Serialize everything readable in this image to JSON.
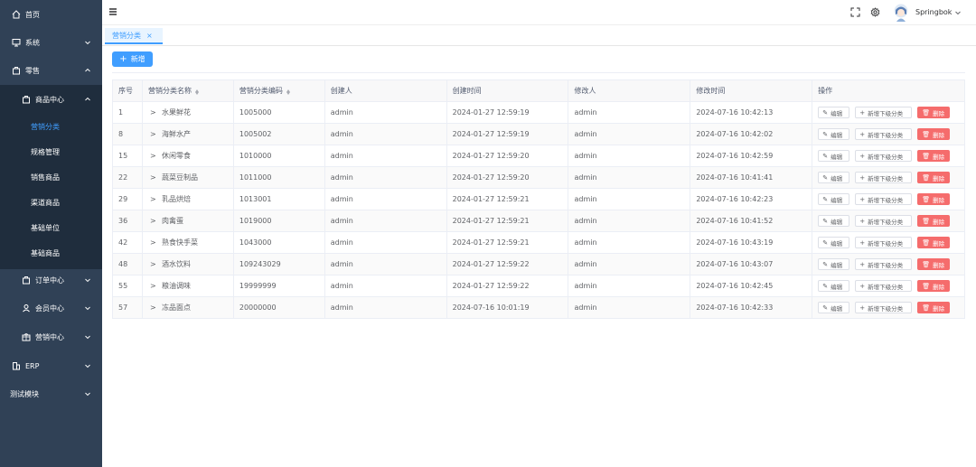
{
  "sidebar": {
    "items": [
      {
        "label": "首页",
        "icon": "home-icon"
      },
      {
        "label": "系统",
        "icon": "monitor-icon"
      },
      {
        "label": "零售",
        "icon": "shop-icon"
      },
      {
        "label": "商品中心",
        "icon": "bag-icon"
      },
      {
        "label": "营销分类",
        "icon": ""
      },
      {
        "label": "规格管理",
        "icon": ""
      },
      {
        "label": "销售商品",
        "icon": ""
      },
      {
        "label": "渠道商品",
        "icon": ""
      },
      {
        "label": "基础单位",
        "icon": ""
      },
      {
        "label": "基础商品",
        "icon": ""
      },
      {
        "label": "订单中心",
        "icon": "order-icon"
      },
      {
        "label": "会员中心",
        "icon": "user-icon"
      },
      {
        "label": "营销中心",
        "icon": "marketing-icon"
      },
      {
        "label": "ERP",
        "icon": "building-icon"
      },
      {
        "label": "测试模块",
        "icon": ""
      }
    ]
  },
  "header": {
    "username": "Springbok"
  },
  "tags": [
    {
      "label": "营销分类",
      "close": "×"
    }
  ],
  "toolbar": {
    "add_label": "新增",
    "add_icon": "+"
  },
  "table": {
    "headers": [
      "序号",
      "营销分类名称",
      "营销分类编码",
      "创建人",
      "创建时间",
      "修改人",
      "修改时间",
      "操作"
    ],
    "expander": ">",
    "actions": {
      "edit": "编辑",
      "add_sub": "新增下级分类",
      "delete": "删除"
    },
    "rows": [
      {
        "id": "1",
        "name": "水果鲜花",
        "code": "1005000",
        "creator": "admin",
        "created": "2024-01-27 12:59:19",
        "modifier": "admin",
        "modified": "2024-07-16 10:42:13"
      },
      {
        "id": "8",
        "name": "海鲜水产",
        "code": "1005002",
        "creator": "admin",
        "created": "2024-01-27 12:59:19",
        "modifier": "admin",
        "modified": "2024-07-16 10:42:02"
      },
      {
        "id": "15",
        "name": "休闲零食",
        "code": "1010000",
        "creator": "admin",
        "created": "2024-01-27 12:59:20",
        "modifier": "admin",
        "modified": "2024-07-16 10:42:59"
      },
      {
        "id": "22",
        "name": "蔬菜豆制品",
        "code": "1011000",
        "creator": "admin",
        "created": "2024-01-27 12:59:20",
        "modifier": "admin",
        "modified": "2024-07-16 10:41:41"
      },
      {
        "id": "29",
        "name": "乳品烘焙",
        "code": "1013001",
        "creator": "admin",
        "created": "2024-01-27 12:59:21",
        "modifier": "admin",
        "modified": "2024-07-16 10:42:23"
      },
      {
        "id": "36",
        "name": "肉禽蛋",
        "code": "1019000",
        "creator": "admin",
        "created": "2024-01-27 12:59:21",
        "modifier": "admin",
        "modified": "2024-07-16 10:41:52"
      },
      {
        "id": "42",
        "name": "熟食快手菜",
        "code": "1043000",
        "creator": "admin",
        "created": "2024-01-27 12:59:21",
        "modifier": "admin",
        "modified": "2024-07-16 10:43:19"
      },
      {
        "id": "48",
        "name": "酒水饮料",
        "code": "109243029",
        "creator": "admin",
        "created": "2024-01-27 12:59:22",
        "modifier": "admin",
        "modified": "2024-07-16 10:43:07"
      },
      {
        "id": "55",
        "name": "粮油调味",
        "code": "19999999",
        "creator": "admin",
        "created": "2024-01-27 12:59:22",
        "modifier": "admin",
        "modified": "2024-07-16 10:42:45"
      },
      {
        "id": "57",
        "name": "冻品面点",
        "code": "20000000",
        "creator": "admin",
        "created": "2024-07-16 10:01:19",
        "modifier": "admin",
        "modified": "2024-07-16 10:42:33"
      }
    ]
  },
  "colors": {
    "sidebar_bg": "#304156",
    "submenu_bg": "#1f2d3d",
    "primary": "#409eff",
    "danger": "#f56c6c"
  }
}
